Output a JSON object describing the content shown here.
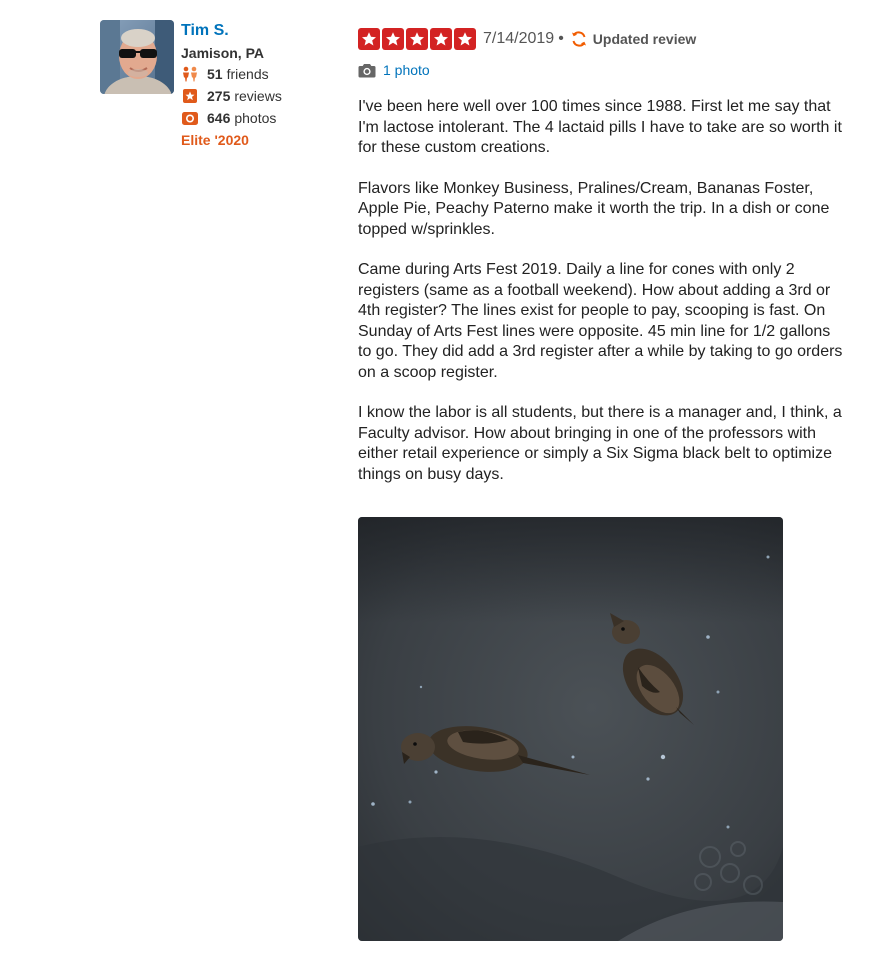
{
  "user": {
    "name": "Tim S.",
    "location": "Jamison, PA",
    "stats": {
      "friends_count": "51",
      "friends_label": "friends",
      "reviews_count": "275",
      "reviews_label": "reviews",
      "photos_count": "646",
      "photos_label": "photos"
    },
    "elite": "Elite '2020",
    "icons": {
      "friends": "friends-icon",
      "reviews": "review-star-icon",
      "photos": "camera-icon"
    }
  },
  "review": {
    "rating": 5,
    "rating_max": 5,
    "date": "7/14/2019",
    "separator": "•",
    "updated_label": "Updated review",
    "photo_link": "1 photo",
    "paragraphs": [
      "I've been here well over 100 times since 1988. First let me say that I'm lactose intolerant. The 4 lactaid pills I have to take are so worth it for these custom creations.",
      "Flavors like Monkey Business, Pralines/Cream, Bananas Foster, Apple Pie, Peachy Paterno make it worth the trip. In a dish or cone topped w/sprinkles.",
      "Came during Arts Fest 2019. Daily a line for cones with only 2 registers (same as a football weekend). How about adding a 3rd or 4th register?  The lines exist for people to pay, scooping is fast. On Sunday of Arts Fest lines were opposite. 45 min line for 1/2 gallons to go. They did add a 3rd register after a while by taking to go orders on a scoop register.",
      "I know the labor is all students, but there is a manager and, I think, a Faculty advisor. How about bringing in one of the professors with either retail experience or simply a Six Sigma black belt to optimize things on busy days."
    ]
  },
  "colors": {
    "link": "#0073bb",
    "star": "#d32323",
    "elite": "#e05a1b",
    "stat_icon": "#e05a1b",
    "updated_icon": "#f15c00"
  }
}
